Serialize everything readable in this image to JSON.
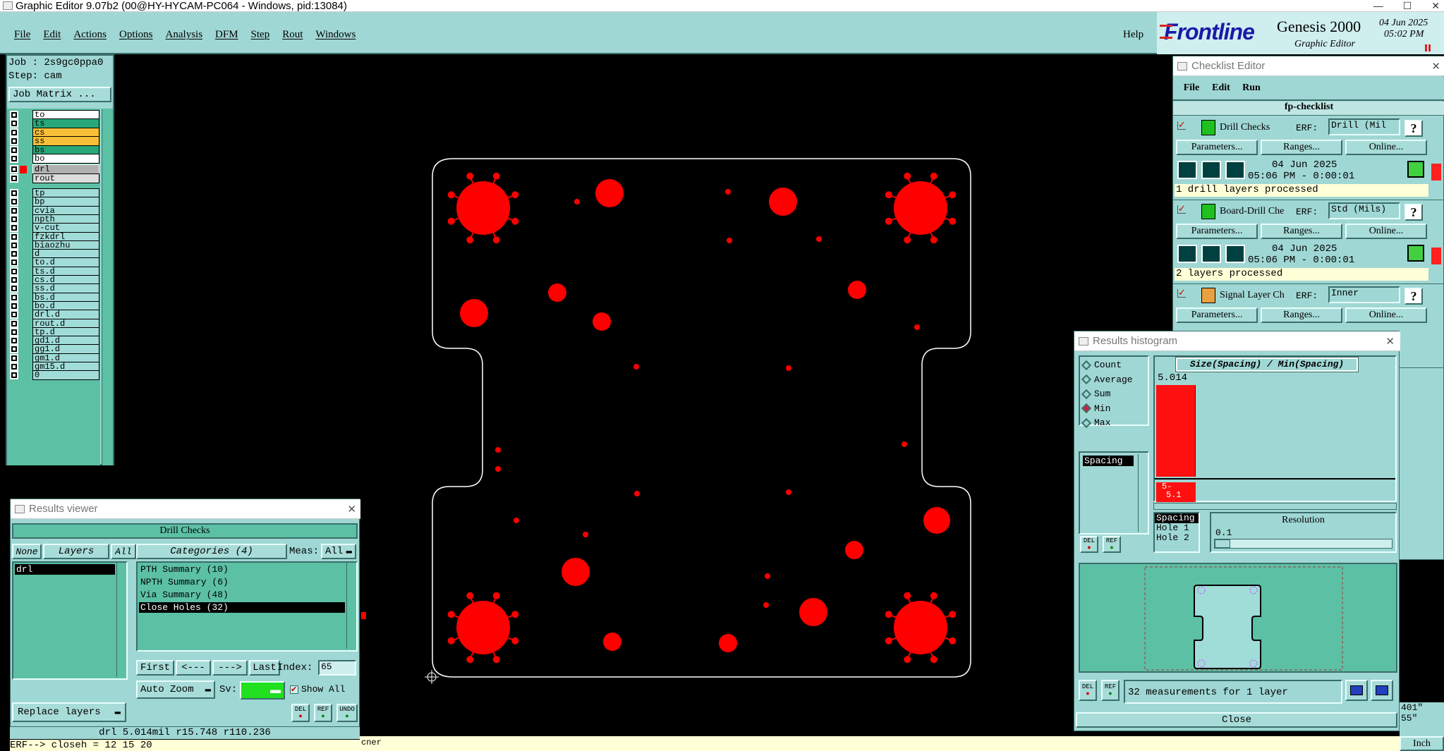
{
  "window_title": "Graphic Editor 9.07b2 (00@HY-HYCAM-PC064 - Windows, pid:13084)",
  "menu": [
    "File",
    "Edit",
    "Actions",
    "Options",
    "Analysis",
    "DFM",
    "Step",
    "Rout",
    "Windows"
  ],
  "help_label": "Help",
  "brand": {
    "logo": "Frontline",
    "product": "Genesis 2000",
    "subtitle": "Graphic Editor",
    "date": "04 Jun 2025",
    "time": "05:02 PM"
  },
  "job": {
    "job_line": "Job : 2s9gc0ppa0",
    "step_line": "Step: cam",
    "job_matrix": "Job Matrix ..."
  },
  "layers_top": [
    {
      "name": "to",
      "color": "#ffffff"
    },
    {
      "name": "ts",
      "color": "#28a878"
    },
    {
      "name": "cs",
      "color": "#f8c038"
    },
    {
      "name": "ss",
      "color": "#f8c038"
    },
    {
      "name": "bs",
      "color": "#28a878"
    },
    {
      "name": "bo",
      "color": "#ffffff"
    }
  ],
  "layers_mid": [
    {
      "name": "drl",
      "color": "#b0b0b0"
    },
    {
      "name": "rout",
      "color": "#dcdcdc"
    }
  ],
  "layers_bottom": [
    "tp",
    "bp",
    "cvia",
    "npth",
    "v-cut",
    "fzkdrl",
    "biaozhu",
    "d",
    "to.d",
    "ts.d",
    "cs.d",
    "ss.d",
    "bs.d",
    "bo.d",
    "drl.d",
    "rout.d",
    "tp.d",
    "gd1.d",
    "gg1.d",
    "gm1.d",
    "gm15.d",
    "0"
  ],
  "colors": {
    "board_outline": "#ffffff",
    "drill": "#ff0000",
    "panel": "#9fd7d4",
    "active_green": "#5cc0a4"
  },
  "checklist": {
    "title": "Checklist Editor",
    "menu": [
      "File",
      "Edit",
      "Run"
    ],
    "name": "fp-checklist",
    "items": [
      {
        "name": "Drill Checks",
        "erf_label": "ERF:",
        "erf": "Drill (Mil",
        "params": "Parameters...",
        "ranges": "Ranges...",
        "online": "Online...",
        "date": "04 Jun 2025",
        "time": "05:06 PM - 0:00:01",
        "status": "1 drill layers processed"
      },
      {
        "name": "Board-Drill Che",
        "erf_label": "ERF:",
        "erf": "Std (Mils)",
        "params": "Parameters...",
        "ranges": "Ranges...",
        "online": "Online...",
        "date": "04 Jun 2025",
        "time": "05:06 PM - 0:00:01",
        "status": "2 layers processed"
      },
      {
        "name": "Signal Layer Ch",
        "erf_label": "ERF:",
        "erf": "Inner",
        "params": "Parameters...",
        "ranges": "Ranges...",
        "online": "Online..."
      }
    ],
    "q": "?"
  },
  "histogram": {
    "title": "Results histogram",
    "modes": [
      "Count",
      "Average",
      "Sum",
      "Min",
      "Max"
    ],
    "selected_mode": "Min",
    "meas_list": [
      "Spacing"
    ],
    "chart_title": "Size(Spacing) / Min(Spacing)",
    "bar_value": "5.014",
    "bar_label_1": "5-",
    "bar_label_2": "5.1",
    "fields": [
      "Spacing",
      "Hole 1",
      "Hole 2"
    ],
    "resolution_label": "Resolution",
    "resolution_value": "0.1",
    "summary": "32 measurements for 1 layer",
    "close": "Close",
    "del": "DEL",
    "ref": "REF"
  },
  "results_viewer": {
    "title": "Results viewer",
    "header": "Drill Checks",
    "none": "None",
    "layers": "Layers",
    "all": "All",
    "layer_items": [
      "drl"
    ],
    "categories_label": "Categories (4)",
    "meas_label": "Meas:",
    "meas_value": "All",
    "categories": [
      "PTH Summary (10)",
      "NPTH Summary (6)",
      "Via Summary (48)",
      "Close Holes (32)"
    ],
    "selected_category": 3,
    "nav": [
      "First",
      "<---",
      "--->",
      "Last"
    ],
    "index_label": "Index:",
    "index_value": "65",
    "auto_zoom": "Auto Zoom",
    "sv_label": "Sv:",
    "show_all": "Show All",
    "replace_layers": "Replace layers",
    "del": "DEL",
    "ref": "REF",
    "undo": "UNDO"
  },
  "status": {
    "readout": "drl 5.014mil  r15.748  r110.236",
    "erf_line": "ERF--> closeh = 12 15 20",
    "cner": "cner",
    "unit": "Inch",
    "coord1": "401\"",
    "coord2": "55\""
  }
}
